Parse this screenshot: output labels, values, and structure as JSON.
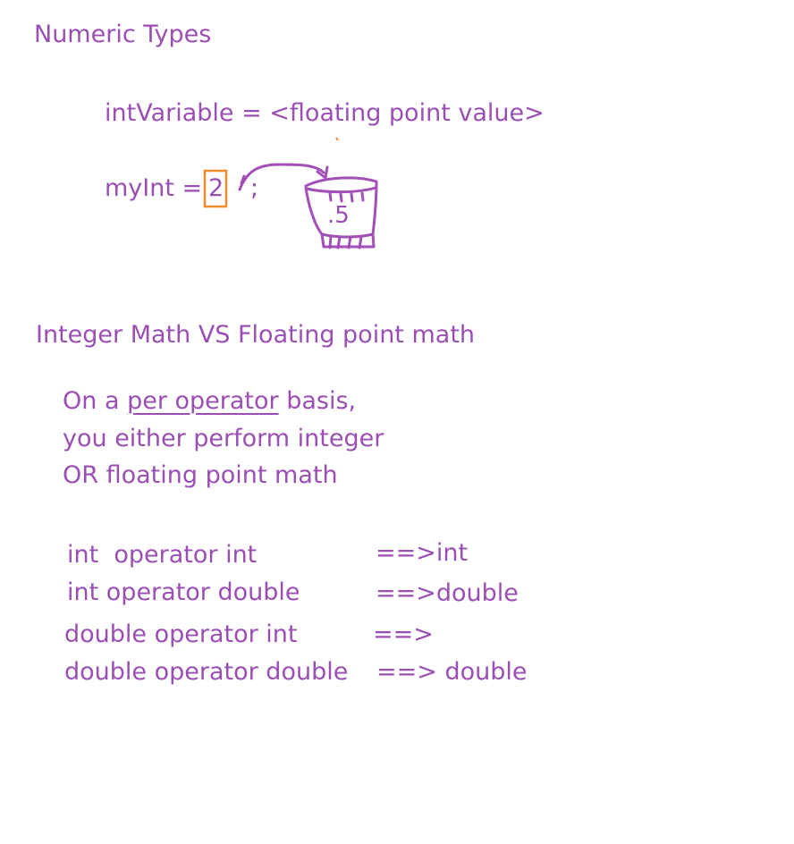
{
  "colors": {
    "text": "#9b4fb4",
    "highlight_box": "#f08a2a",
    "ink": "#a24fb8"
  },
  "section1": {
    "title": "Numeric Types",
    "line1": "intVariable = <floating point value>",
    "line2_prefix": "myInt =",
    "line2_digit": "2",
    "line2_suffix": ";",
    "bucket_value": ".5"
  },
  "section2": {
    "title": "Integer Math VS Floating point math",
    "para_line1_prefix": "On a ",
    "para_line1_underlined": "per operator",
    "para_line1_suffix": " basis,",
    "para_line2": "you either perform integer",
    "para_line3": "OR floating point math",
    "rules": [
      {
        "left": "int  operator int",
        "right": "==>int"
      },
      {
        "left": "int operator double",
        "right": "==>double"
      },
      {
        "left": "double operator int",
        "right": "==>"
      },
      {
        "left": "double operator double",
        "right": "==> double"
      }
    ]
  }
}
